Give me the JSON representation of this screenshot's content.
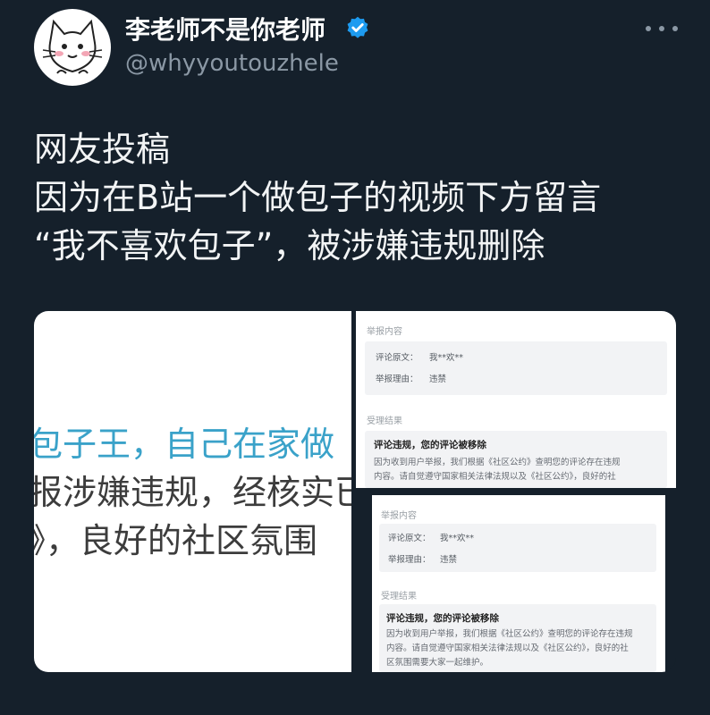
{
  "author": {
    "display_name": "李老师不是你老师",
    "handle": "@whyyoutouzhele",
    "verified_icon": "verified-badge-icon",
    "avatar_icon": "cartoon-cat-avatar"
  },
  "tweet": {
    "lines": [
      "网友投稿",
      "因为在B站一个做包子的视频下方留言",
      "“我不喜欢包子”，被涉嫌违规删除"
    ]
  },
  "media": {
    "crop": {
      "line1": "包子王，自己在家做",
      "line2": "报涉嫌违规，经核实已",
      "line3": "》，良好的社区氛围"
    },
    "screenshot1": {
      "section_report": "举报内容",
      "label_comment": "评论原文：",
      "value_comment": "我**欢**",
      "label_reason": "举报理由：",
      "value_reason": "违禁",
      "section_result": "受理结果",
      "result_title": "评论违规，您的评论被移除",
      "result_line1": "因为收到用户举报，我们根据《社区公约》查明您的评论存在违规",
      "result_line2": "内容。请自觉遵守国家相关法律法规以及《社区公约》，良好的社"
    },
    "screenshot2": {
      "section_report": "举报内容",
      "label_comment": "评论原文：",
      "value_comment": "我**欢**",
      "label_reason": "举报理由：",
      "value_reason": "违禁",
      "section_result": "受理结果",
      "result_title": "评论违规，您的评论被移除",
      "result_line1": "因为收到用户举报，我们根据《社区公约》查明您的评论存在违规",
      "result_line2": "内容。请自觉遵守国家相关法律法规以及《社区公约》，良好的社",
      "result_line3": "区氛围需要大家一起维护。"
    }
  },
  "colors": {
    "background": "#15202b",
    "text_primary": "#e7e9ea",
    "text_secondary": "#8b98a5",
    "verified": "#1d9bf0",
    "crop_highlight": "#3aa2c9"
  }
}
